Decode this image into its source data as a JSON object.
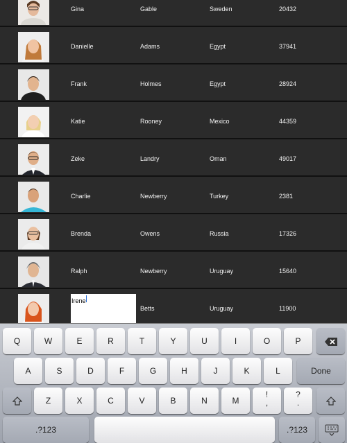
{
  "table": {
    "rows": [
      {
        "first": "Gina",
        "last": "Gable",
        "country": "Sweden",
        "number": "20432"
      },
      {
        "first": "Danielle",
        "last": "Adams",
        "country": "Egypt",
        "number": "37941"
      },
      {
        "first": "Frank",
        "last": "Holmes",
        "country": "Egypt",
        "number": "28924"
      },
      {
        "first": "Katie",
        "last": "Rooney",
        "country": "Mexico",
        "number": "44359"
      },
      {
        "first": "Zeke",
        "last": "Landry",
        "country": "Oman",
        "number": "49017"
      },
      {
        "first": "Charlie",
        "last": "Newberry",
        "country": "Turkey",
        "number": "2381"
      },
      {
        "first": "Brenda",
        "last": "Owens",
        "country": "Russia",
        "number": "17326"
      },
      {
        "first": "Ralph",
        "last": "Newberry",
        "country": "Uruguay",
        "number": "15640"
      }
    ],
    "edit_row": {
      "first_value": "Irene",
      "last": "Betts",
      "country": "Uruguay",
      "number": "11900"
    }
  },
  "keyboard": {
    "row1": [
      "Q",
      "W",
      "E",
      "R",
      "T",
      "Y",
      "U",
      "I",
      "O",
      "P"
    ],
    "row2": [
      "A",
      "S",
      "D",
      "F",
      "G",
      "H",
      "J",
      "K",
      "L"
    ],
    "row3": [
      "Z",
      "X",
      "C",
      "V",
      "B",
      "N",
      "M"
    ],
    "excl_top": "!",
    "excl_bottom": ",",
    "quest_top": "?",
    "quest_bottom": ".",
    "done_label": "Done",
    "numbers_label": ".?123",
    "numbers_label_right": ".?123"
  },
  "icons": {
    "backspace": "backspace-icon",
    "shift": "shift-icon",
    "hide_keyboard": "keyboard-hide-icon"
  },
  "colors": {
    "table_bg": "#2b2b2b",
    "row_divider": "#111111",
    "text": "#f2f2f2",
    "keyboard_bg": "#b3b7bf",
    "caret": "#2a6fd6"
  }
}
